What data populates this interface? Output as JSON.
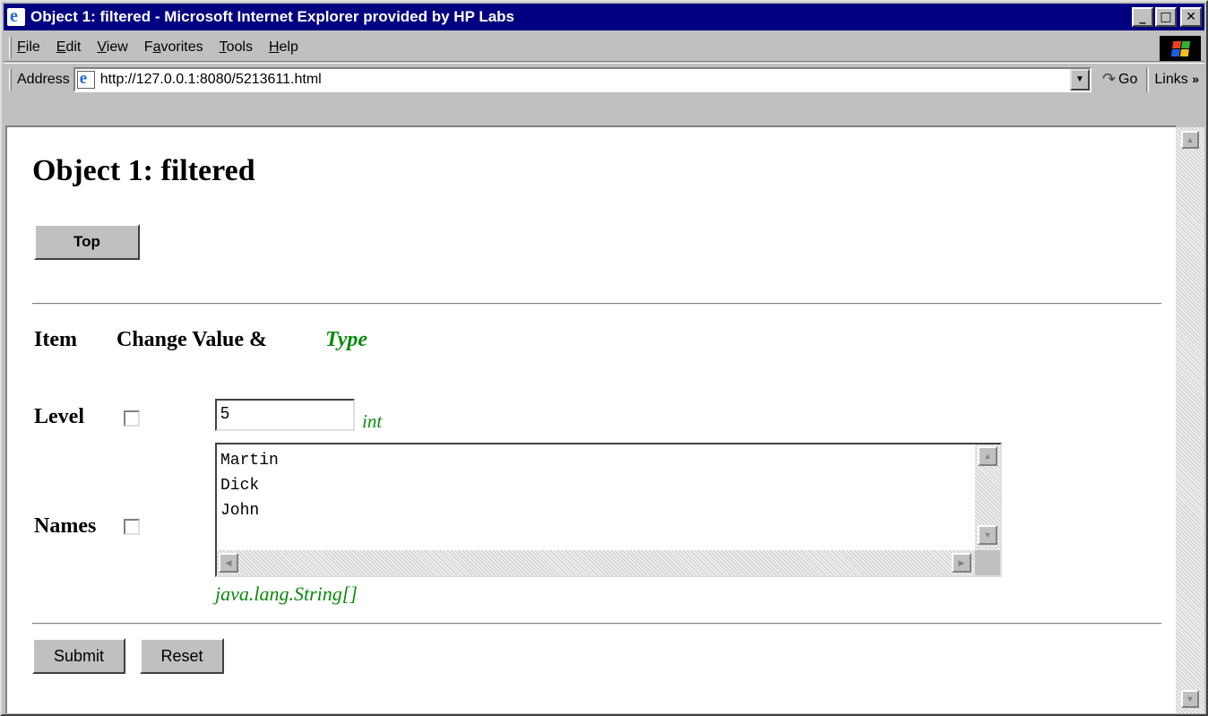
{
  "window": {
    "title": "Object 1: filtered - Microsoft Internet Explorer provided by HP Labs",
    "minimize": "_",
    "maximize": "□",
    "close": "✕"
  },
  "menu": {
    "items": [
      "File",
      "Edit",
      "View",
      "Favorites",
      "Tools",
      "Help"
    ],
    "underline_index": [
      0,
      0,
      0,
      1,
      0,
      0
    ]
  },
  "address_bar": {
    "label": "Address",
    "url": "http://127.0.0.1:8080/5213611.html",
    "go_label": "Go",
    "links_label": "Links"
  },
  "page": {
    "title": "Object 1: filtered",
    "top_button": "Top",
    "header": {
      "item": "Item",
      "change_value": "Change Value &",
      "type": "Type"
    },
    "fields": [
      {
        "label": "Level",
        "value": "5",
        "type": "int",
        "checked": false
      },
      {
        "label": "Names",
        "values": [
          "Martin",
          "Dick",
          "John"
        ],
        "type": "java.lang.String[]",
        "checked": false
      }
    ],
    "submit_label": "Submit",
    "reset_label": "Reset"
  },
  "colors": {
    "titlebar": "#000080",
    "type_text": "#0a8a0a",
    "chrome": "#c0c0c0"
  }
}
